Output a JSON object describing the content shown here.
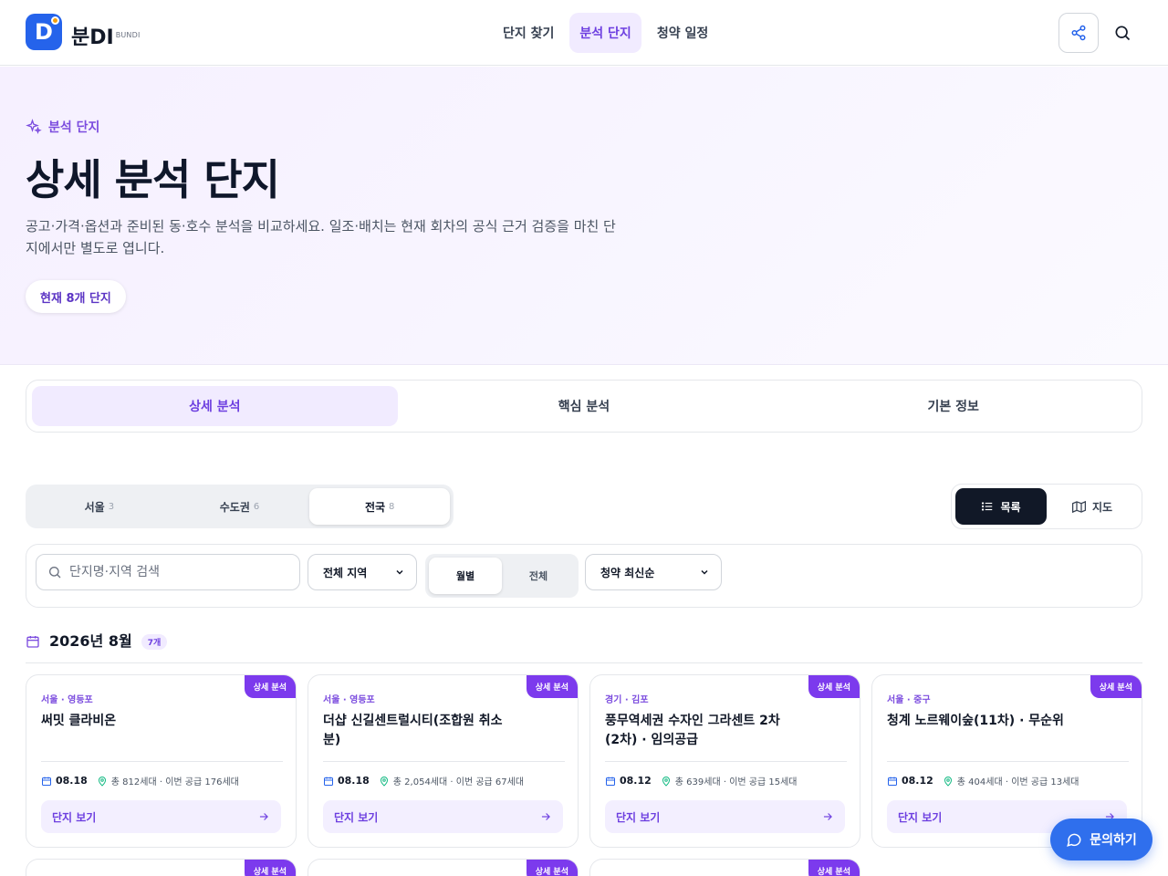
{
  "header": {
    "logo_mark": "D",
    "logo_text": "분DI",
    "logo_sub": "BUNDI",
    "nav": [
      {
        "label": "단지 찾기"
      },
      {
        "label": "분석 단지"
      },
      {
        "label": "청약 일정"
      }
    ]
  },
  "hero": {
    "eyebrow": "분석 단지",
    "title": "상세 분석 단지",
    "description": "공고·가격·옵션과 준비된 동·호수 분석을 비교하세요. 일조·배치는 현재 회차의 공식 근거 검증을 마친 단지에서만 별도로 엽니다.",
    "pill": "현재 8개 단지"
  },
  "main_tabs": [
    {
      "label": "상세 분석"
    },
    {
      "label": "핵심 분석"
    },
    {
      "label": "기본 정보"
    }
  ],
  "region_tabs": [
    {
      "label": "서울",
      "count": "3"
    },
    {
      "label": "수도권",
      "count": "6"
    },
    {
      "label": "전국",
      "count": "8"
    }
  ],
  "view_toggle": {
    "list": "목록",
    "map": "지도"
  },
  "filters": {
    "search_placeholder": "단지명·지역 검색",
    "region_select": "전체 지역",
    "period": [
      "월별",
      "전체"
    ],
    "sort_select": "청약 최신순"
  },
  "month": {
    "title": "2026년 8월",
    "count": "7개"
  },
  "cards": [
    {
      "badge": "상세 분석",
      "region": "서울 · 영등포",
      "name": "써밋 클라비온",
      "date": "08.18",
      "units": "총 812세대 · 이번 공급 176세대",
      "button": "단지 보기"
    },
    {
      "badge": "상세 분석",
      "region": "서울 · 영등포",
      "name": "더샵 신길센트럴시티(조합원 취소분)",
      "date": "08.18",
      "units": "총 2,054세대 · 이번 공급 67세대",
      "button": "단지 보기"
    },
    {
      "badge": "상세 분석",
      "region": "경기 · 김포",
      "name": "풍무역세권 수자인 그라센트 2차(2차) · 임의공급",
      "date": "08.12",
      "units": "총 639세대 · 이번 공급 15세대",
      "button": "단지 보기"
    },
    {
      "badge": "상세 분석",
      "region": "서울 · 중구",
      "name": "청계 노르웨이숲(11차) · 무순위",
      "date": "08.12",
      "units": "총 404세대 · 이번 공급 13세대",
      "button": "단지 보기"
    }
  ],
  "next_row_badges": [
    "상세 분석",
    "상세 분석",
    "상세 분석"
  ],
  "contact": {
    "label": "문의하기"
  },
  "colors": {
    "accent": "#6d3fe0",
    "badge": "#7c3aed",
    "contact": "#2f6fed",
    "logo": "#2563eb"
  }
}
